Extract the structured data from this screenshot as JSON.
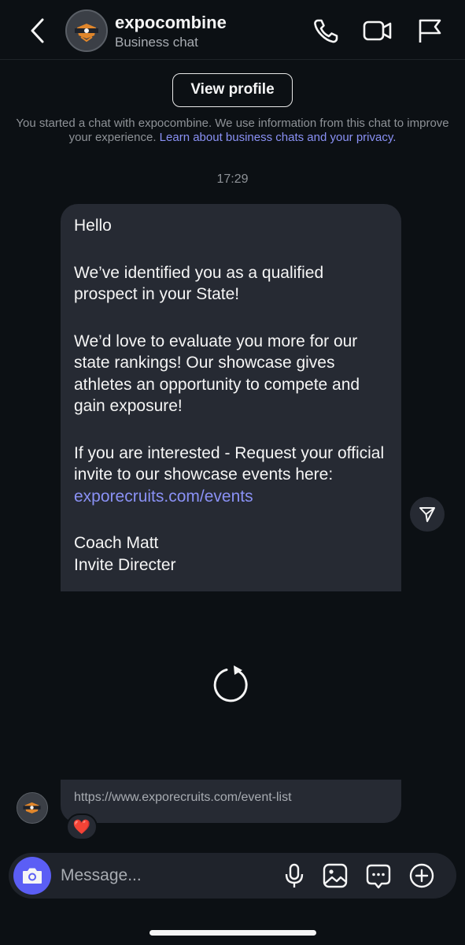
{
  "header": {
    "title": "expocombine",
    "subtitle": "Business chat",
    "icons": [
      "back-chevron-icon",
      "phone-icon",
      "video-icon",
      "flag-icon"
    ]
  },
  "profile": {
    "view_profile_label": "View profile",
    "notice_text": "You started a chat with expocombine. We use information from this chat to improve your experience.",
    "notice_link": "Learn about business chats and your privacy."
  },
  "timestamp": "17:29",
  "message": {
    "greeting": "Hello",
    "para1": "We’ve identified you as a qualified prospect in your State!",
    "para2": "We’d love to evaluate you more for our state rankings! Our showcase gives athletes an opportunity to compete and gain exposure!",
    "para3_text": "If you are interested - Request your official invite to our showcase events here: ",
    "para3_link": "exporecruits.com/events",
    "signature_name": "Coach Matt",
    "signature_title": "Invite Directer"
  },
  "link_message": {
    "url": "https://www.exporecruits.com/event-list",
    "reaction": "❤️"
  },
  "composer": {
    "placeholder": "Message...",
    "icons": [
      "camera-icon",
      "microphone-icon",
      "gallery-icon",
      "sticker-chat-icon",
      "plus-icon"
    ]
  },
  "colors": {
    "background": "#0c1014",
    "bubble": "#262a33",
    "link": "#8a91f5",
    "camera_button": "#5b5ef5"
  }
}
